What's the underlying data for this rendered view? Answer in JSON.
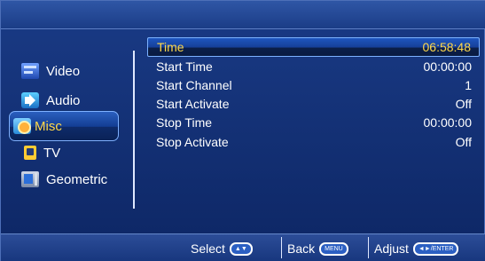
{
  "sidebar": {
    "items": [
      {
        "label": "Video",
        "icon": "video-icon"
      },
      {
        "label": "Audio",
        "icon": "audio-icon"
      },
      {
        "label": "Misc",
        "icon": "misc-icon"
      },
      {
        "label": "TV",
        "icon": "tv-icon"
      },
      {
        "label": "Geometric",
        "icon": "geometric-icon"
      }
    ],
    "selected_index": 2
  },
  "settings": {
    "rows": [
      {
        "name": "Time",
        "value": "06:58:48"
      },
      {
        "name": "Start Time",
        "value": "00:00:00"
      },
      {
        "name": "Start Channel",
        "value": "1"
      },
      {
        "name": "Start  Activate",
        "value": "Off"
      },
      {
        "name": "Stop Time",
        "value": "00:00:00"
      },
      {
        "name": "Stop  Activate",
        "value": "Off"
      }
    ],
    "highlighted_index": 0
  },
  "bottom_bar": {
    "select_label": "Select",
    "select_key": "▲▼",
    "back_label": "Back",
    "back_key": "MENU",
    "adjust_label": "Adjust",
    "adjust_key": "◄►/ENTER"
  },
  "colors": {
    "accent_yellow": "#ffd84a",
    "panel_blue": "#163f98",
    "highlight_border": "#7db2ff"
  }
}
